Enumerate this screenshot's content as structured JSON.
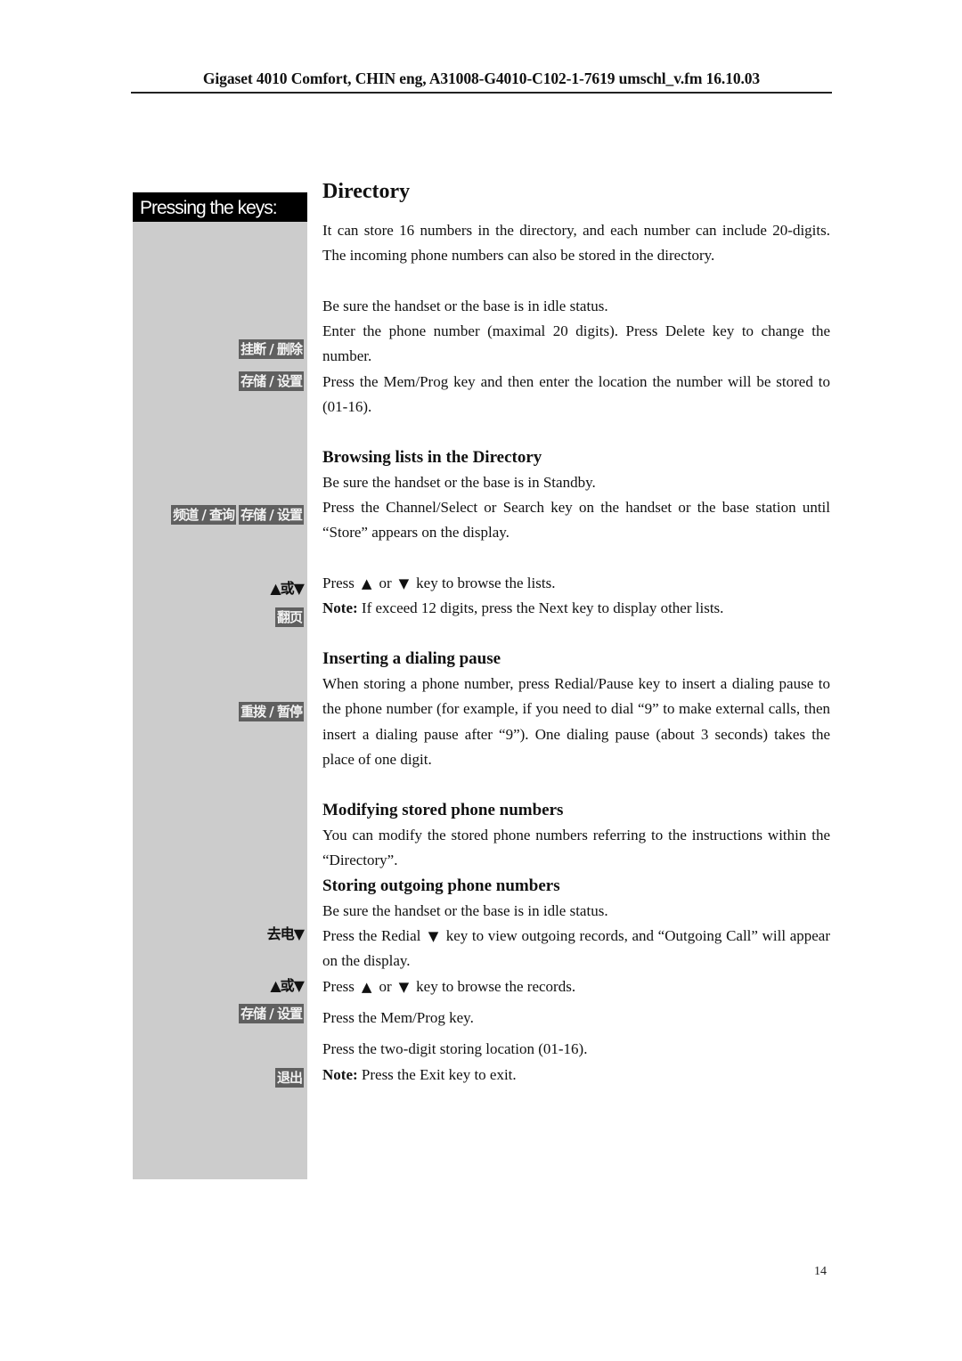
{
  "header": {
    "text": "Gigaset 4010 Comfort, CHIN eng, A31008-G4010-C102-1-7619 umschl_v.fm 16.10.03"
  },
  "sidebar": {
    "title": "Pressing the keys:",
    "keys": {
      "hangup_delete": "挂断 / 删除",
      "store_set_1": "存储 / 设置",
      "channel_search": "频道 / 查询",
      "store_set_2": "存储 / 设置",
      "up_or_down_1": "▲或▼",
      "page_turn": "翻页",
      "redial_pause": "重拨 / 暂停",
      "outgoing_down": "去电▼",
      "up_or_down_2": "▲或▼",
      "store_set_3": "存储 / 设置",
      "exit": "退出"
    }
  },
  "main": {
    "title": "Directory",
    "intro": {
      "p1": "It can store 16 numbers in the directory, and each number can include 20-digits. The incoming phone numbers can also be stored in the directory.",
      "p2": "Be sure the handset or the base is in idle status.",
      "p3": "Enter the phone number (maximal 20 digits). Press Delete key to change the number.",
      "p4": "Press the Mem/Prog key and then enter the location the number will be stored to (01-16)."
    },
    "browsing": {
      "heading": "Browsing lists in the Directory",
      "p1": "Be sure the handset or the base is in Standby.",
      "p2": "Press the Channel/Select or Search key on the handset or the base station until “Store” appears on the display.",
      "p3_pre": "Press",
      "p3_up": "▲",
      "p3_or": "or",
      "p3_down": "▼",
      "p3_post": "key to browse the lists.",
      "note_label": "Note:",
      "note_text": " If exceed 12 digits, press the Next key to display other lists."
    },
    "pause": {
      "heading": "Inserting a dialing pause",
      "p1": "When storing a phone number, press Redial/Pause key to insert a dialing pause to the phone number (for example, if you need to dial “9” to make external calls, then insert a dialing pause after “9”). One dialing pause (about 3 seconds) takes the place of one digit."
    },
    "modifying": {
      "heading": "Modifying stored phone numbers",
      "p1": "You can modify the stored phone numbers referring to the instructions within the “Directory”."
    },
    "outgoing": {
      "heading": "Storing outgoing phone numbers",
      "p1": "Be sure the handset or the base is in idle status.",
      "p2_pre": "Press the Redial",
      "p2_down": "▼",
      "p2_post": "key to view outgoing records, and “Outgoing Call” will appear on the display.",
      "p3_pre": "Press",
      "p3_up": "▲",
      "p3_or": "or",
      "p3_down": "▼",
      "p3_post": "key to browse the records.",
      "p4": "Press the Mem/Prog key.",
      "p5": "Press the two-digit storing location (01-16).",
      "note_label": "Note:",
      "note_text": " Press the Exit key to exit."
    }
  },
  "footer": {
    "page_number": "14"
  }
}
